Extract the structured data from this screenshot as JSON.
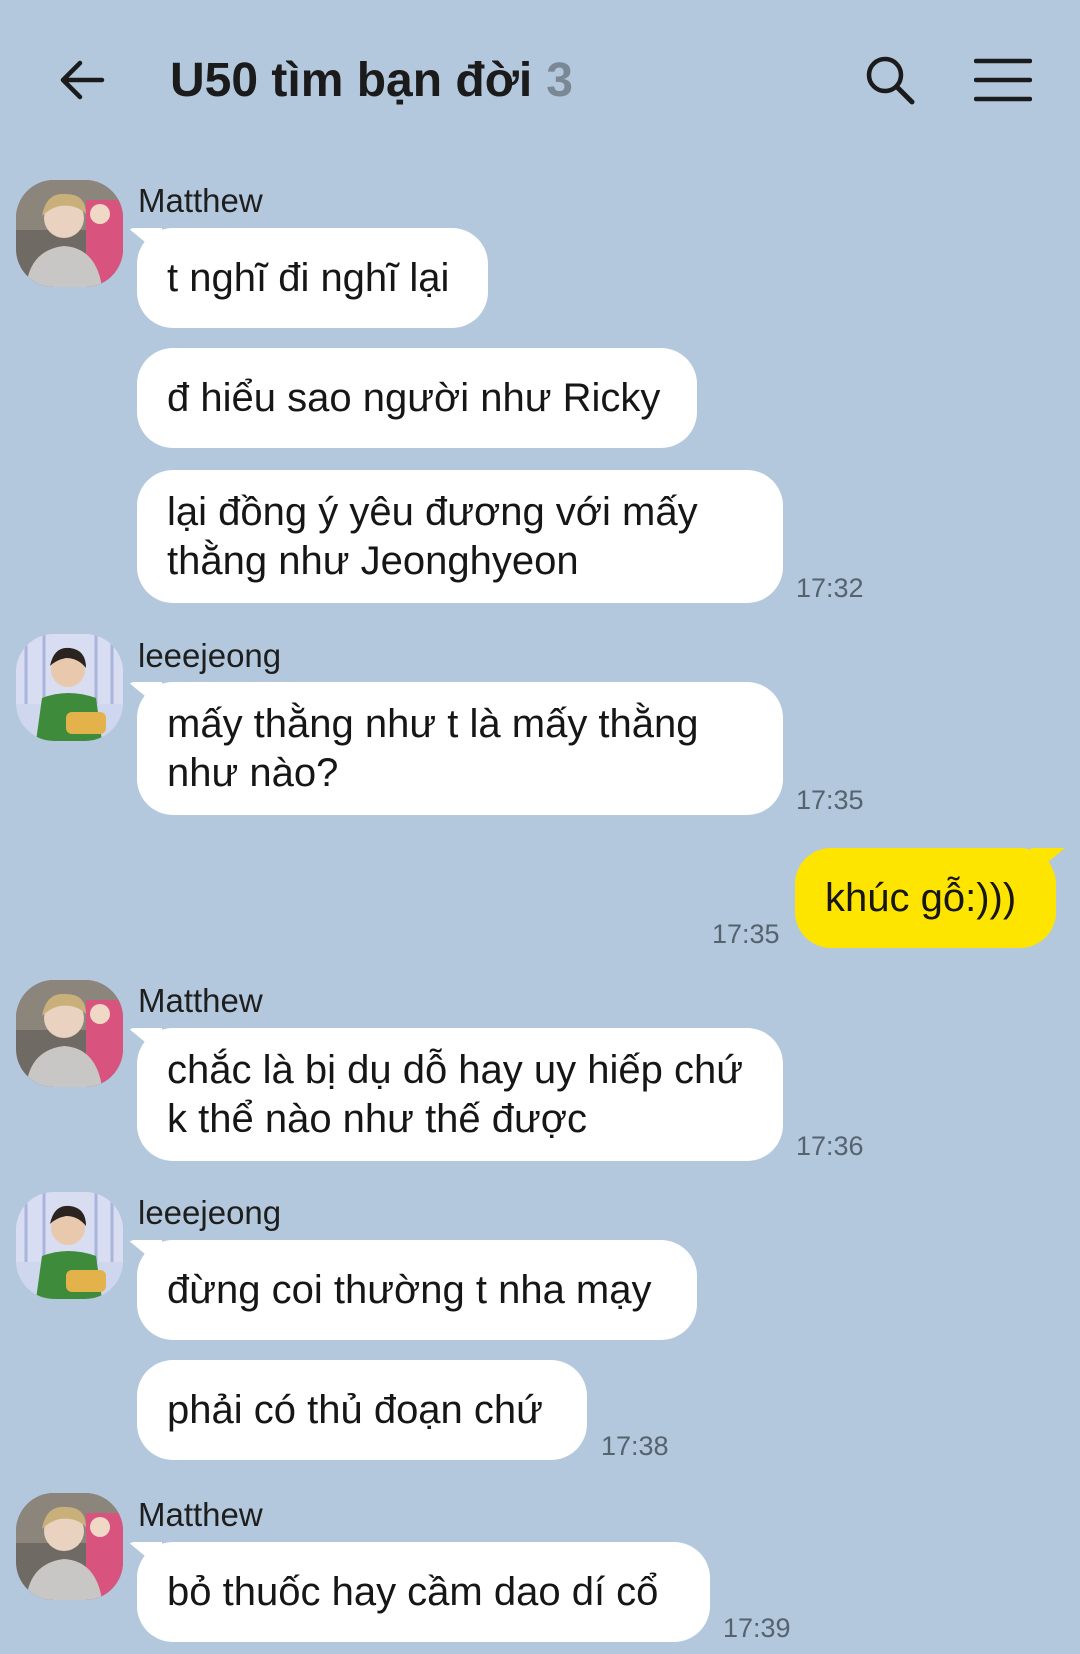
{
  "header": {
    "title": "U50 tìm bạn đời",
    "member_count": "3",
    "back_icon": "arrow-left-icon",
    "search_icon": "search-icon",
    "menu_icon": "hamburger-menu-icon"
  },
  "colors": {
    "background": "#b3c8dd",
    "incoming_bubble": "#ffffff",
    "outgoing_bubble": "#fee500"
  },
  "messages": [
    {
      "sender": "Matthew",
      "texts": [
        "t nghĩ đi nghĩ lại",
        "đ hiểu sao người như Ricky",
        "lại đồng ý yêu đương với mấy thằng như Jeonghyeon"
      ],
      "time": "17:32"
    },
    {
      "sender": "leeejeong",
      "texts": [
        "mấy thằng như t là mấy thằng như nào?"
      ],
      "time": "17:35"
    },
    {
      "sender": "me",
      "texts": [
        "khúc gỗ:)))"
      ],
      "time": "17:35"
    },
    {
      "sender": "Matthew",
      "texts": [
        "chắc là bị dụ dỗ hay uy hiếp chứ k thể nào như thế được"
      ],
      "time": "17:36"
    },
    {
      "sender": "leeejeong",
      "texts": [
        "đừng coi thường t nha mạy",
        "phải có thủ đoạn chứ"
      ],
      "time": "17:38"
    },
    {
      "sender": "Matthew",
      "texts": [
        "bỏ thuốc hay cầm dao dí cổ"
      ],
      "time": "17:39"
    }
  ]
}
